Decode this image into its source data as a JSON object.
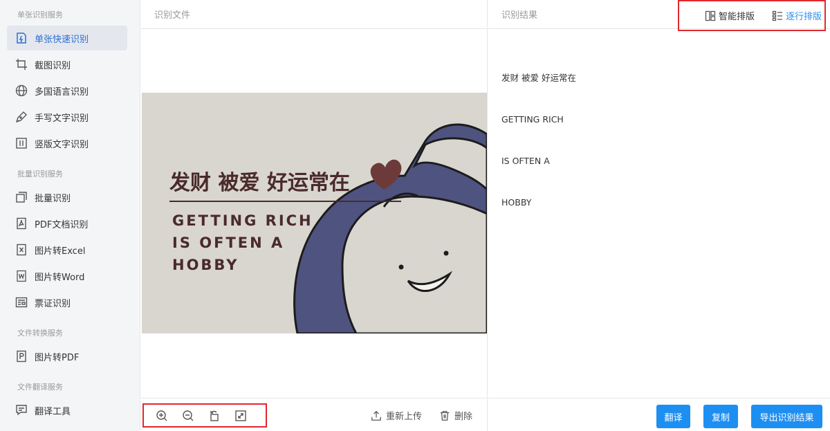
{
  "sidebar": {
    "groups": [
      {
        "title": "单张识别服务"
      },
      {
        "title": "批量识别服务"
      },
      {
        "title": "文件转换服务"
      },
      {
        "title": "文件翻译服务"
      }
    ],
    "items": [
      {
        "label": "单张快速识别",
        "icon": "quick-scan-icon"
      },
      {
        "label": "截图识别",
        "icon": "crop-icon"
      },
      {
        "label": "多国语言识别",
        "icon": "globe-icon"
      },
      {
        "label": "手写文字识别",
        "icon": "pen-icon"
      },
      {
        "label": "竖版文字识别",
        "icon": "vertical-text-icon"
      },
      {
        "label": "批量识别",
        "icon": "stack-icon"
      },
      {
        "label": "PDF文档识别",
        "icon": "pdf-icon"
      },
      {
        "label": "图片转Excel",
        "icon": "excel-icon"
      },
      {
        "label": "图片转Word",
        "icon": "word-icon"
      },
      {
        "label": "票证识别",
        "icon": "ticket-icon"
      },
      {
        "label": "图片转PDF",
        "icon": "pdf-p-icon"
      },
      {
        "label": "翻译工具",
        "icon": "translate-icon"
      }
    ],
    "active_index": 0
  },
  "file_panel": {
    "title": "识别文件",
    "tools": [
      "zoom-in-icon",
      "zoom-out-icon",
      "rotate-icon",
      "fit-screen-icon"
    ],
    "reupload_label": "重新上传",
    "delete_label": "删除"
  },
  "preview_image": {
    "headline": "发财 被爱 好运常在",
    "lines": [
      "GETTING RICH",
      "IS OFTEN A",
      "HOBBY"
    ]
  },
  "result_panel": {
    "title": "识别结果",
    "smart_layout_label": "智能排版",
    "line_layout_label": "逐行排版",
    "lines": [
      "发财 被爱 好运常在",
      "GETTING RICH",
      "IS OFTEN A",
      "HOBBY"
    ],
    "translate_label": "翻译",
    "copy_label": "复制",
    "export_label": "导出识别结果"
  },
  "colors": {
    "accent": "#1e8ff2",
    "active_text": "#2a6fd6",
    "highlight_border": "#e0282e",
    "image_bg": "#d8d6cf",
    "image_text": "#4a2a2a",
    "image_character_blue": "#4f5380"
  }
}
